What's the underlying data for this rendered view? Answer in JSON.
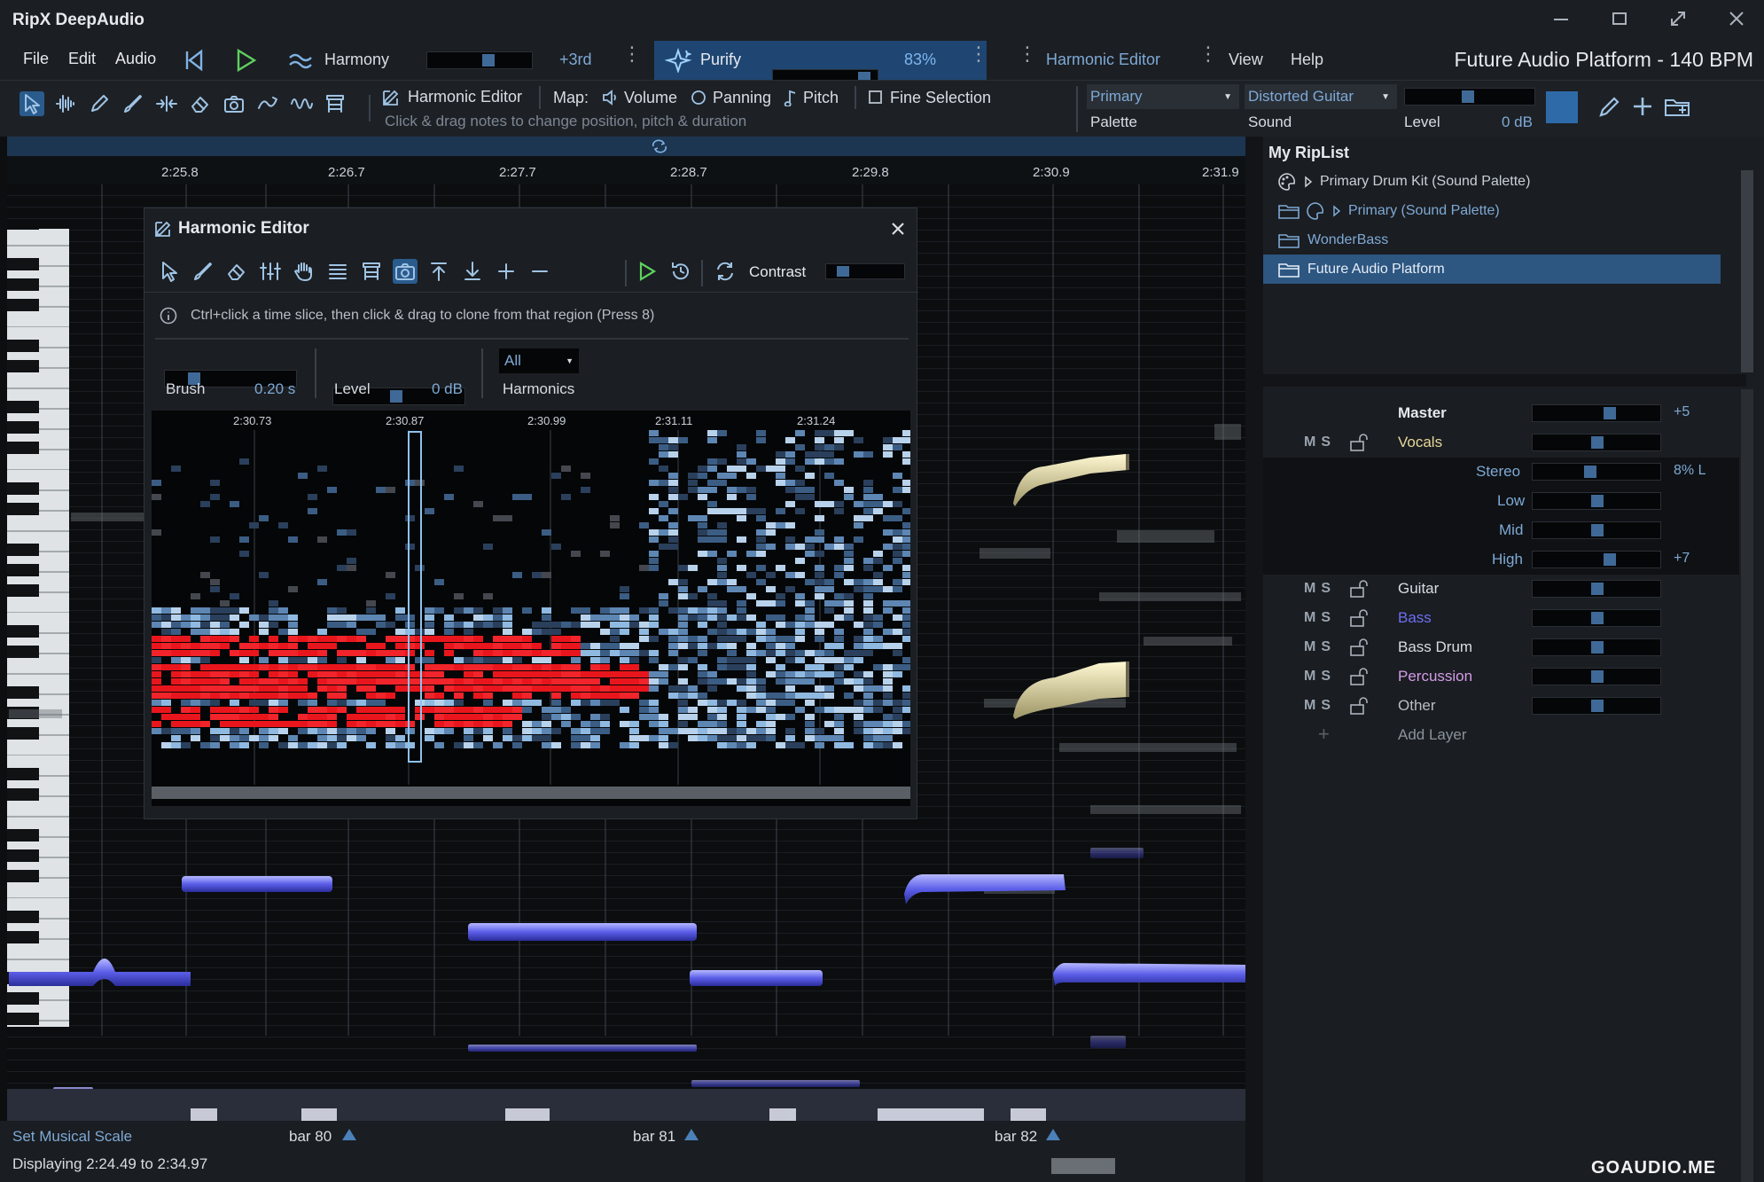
{
  "app": {
    "title": "RipX DeepAudio"
  },
  "window_controls": [
    "minimize-icon",
    "maximize-icon",
    "fullscreen-icon",
    "close-icon"
  ],
  "menu": {
    "file": "File",
    "edit": "Edit",
    "audio": "Audio",
    "harmony": "Harmony",
    "harmony_value": "+3rd",
    "purify": "Purify",
    "purify_value": "83%",
    "harmonic_editor": "Harmonic Editor",
    "view": "View",
    "help": "Help",
    "project_title": "Future Audio Platform - 140 BPM"
  },
  "toolbar": {
    "harmonic_editor": "Harmonic Editor",
    "map_label": "Map:",
    "volume": "Volume",
    "panning": "Panning",
    "pitch": "Pitch",
    "fine_selection": "Fine Selection",
    "hint": "Click & drag notes to change position, pitch & duration",
    "palette_value": "Primary",
    "palette_label": "Palette",
    "sound_value": "Distorted Guitar",
    "sound_label": "Sound",
    "level_label": "Level",
    "level_value": "0 dB",
    "accent": "#2e6aa8"
  },
  "timeline": {
    "ticks": [
      "2:25.8",
      "2:26.7",
      "2:27.7",
      "2:28.7",
      "2:29.8",
      "2:30.9",
      "2:31.9"
    ]
  },
  "harmonic_editor_window": {
    "title": "Harmonic Editor",
    "contrast_label": "Contrast",
    "info": "Ctrl+click a time slice, then click & drag to clone from that region  (Press 8)",
    "brush_label": "Brush",
    "brush_value": "0.20 s",
    "level_label": "Level",
    "level_value": "0 dB",
    "harmonics_value": "All",
    "harmonics_label": "Harmonics",
    "ticks": [
      "2:30.73",
      "2:30.87",
      "2:30.99",
      "2:31.11",
      "2:31.24"
    ]
  },
  "riplist": {
    "title": "My RipList",
    "items": [
      {
        "label": "Primary Drum Kit (Sound Palette)"
      },
      {
        "label": "Primary (Sound Palette)"
      },
      {
        "label": "WonderBass"
      },
      {
        "label": "Future Audio Platform"
      }
    ]
  },
  "mixer": {
    "master": "Master",
    "master_value": "+5",
    "vocals": "Vocals",
    "stereo": "Stereo",
    "stereo_value": "8% L",
    "low": "Low",
    "mid": "Mid",
    "high": "High",
    "high_value": "+7",
    "layers": [
      {
        "name": "Guitar",
        "color": "#d8dde4"
      },
      {
        "name": "Bass",
        "color": "#6d6ff2"
      },
      {
        "name": "Bass Drum",
        "color": "#d8dde4"
      },
      {
        "name": "Percussion",
        "color": "#d49be8"
      },
      {
        "name": "Other",
        "color": "#b8bec6"
      }
    ],
    "add_layer": "Add Layer",
    "m": "M",
    "s": "S",
    "vocals_color": "#e7d79a"
  },
  "status": {
    "set_scale": "Set Musical Scale",
    "bars": [
      "bar 80",
      "bar 81",
      "bar 82"
    ],
    "displaying": "Displaying 2:24.49 to 2:34.97"
  },
  "watermark": "GOAUDIO.ME"
}
